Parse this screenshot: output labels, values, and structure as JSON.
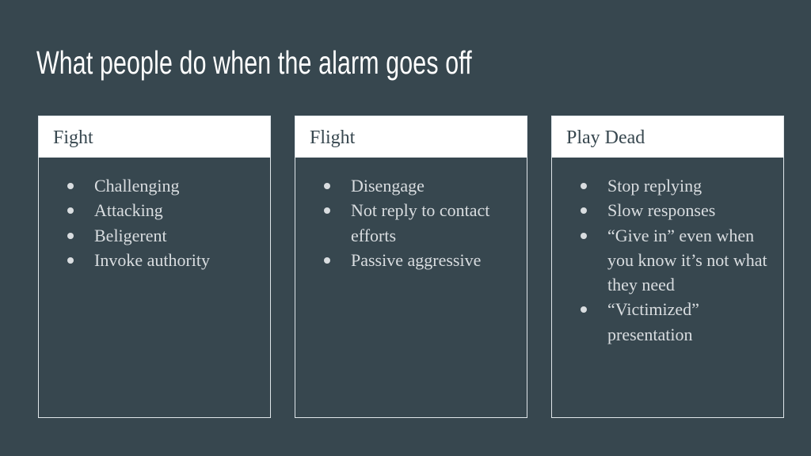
{
  "slide": {
    "title": "What people do when the alarm goes off",
    "colors": {
      "background": "#37474f",
      "card_header": "#ffffff",
      "text": "#d9dde0"
    },
    "columns": [
      {
        "heading": "Fight",
        "items": [
          "Challenging",
          "Attacking",
          "Beligerent",
          "Invoke authority"
        ]
      },
      {
        "heading": "Flight",
        "items": [
          "Disengage",
          "Not reply to contact efforts",
          "Passive aggressive"
        ]
      },
      {
        "heading": "Play Dead",
        "items": [
          "Stop replying",
          "Slow responses",
          "“Give in” even when you know it’s not what they need",
          "“Victimized” presentation"
        ]
      }
    ]
  }
}
